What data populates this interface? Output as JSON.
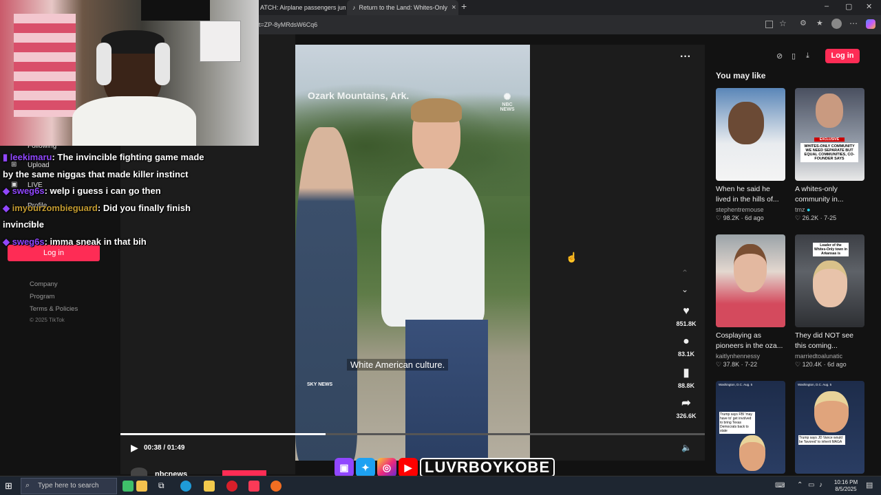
{
  "browser": {
    "tabs": [
      {
        "label": "ATCH: Airplane passengers jum"
      },
      {
        "label": "Return to the Land: Whites-Only"
      }
    ],
    "new_tab": "+",
    "url": "t=ZP-8yMRdsW6Cq6",
    "window": {
      "minimize": "–",
      "maximize": "▢",
      "close": "✕"
    }
  },
  "sidebar": {
    "nav": [
      {
        "label": "Following",
        "icon": "following-icon"
      },
      {
        "label": "Upload",
        "icon": "upload-icon"
      },
      {
        "label": "LIVE",
        "icon": "live-icon"
      },
      {
        "label": "Profile",
        "icon": "profile-icon"
      },
      {
        "label": "More",
        "icon": "more-icon"
      }
    ],
    "login_label": "Log in",
    "footer": [
      "Company",
      "Program",
      "Terms & Policies"
    ],
    "copyright": "© 2025 TikTok"
  },
  "chat": [
    {
      "user": "leekimaru",
      "message": "The invincible fighting game made",
      "cont": "by the same niggas that made killer instinct"
    },
    {
      "user": "sweg6s",
      "message": "welp i guess i can go then",
      "cont": ""
    },
    {
      "user": "imyourzombieguard",
      "message": "Did you finally finish",
      "cont": "invincible"
    },
    {
      "user": "sweg6s",
      "message": "imma sneak in that bih",
      "cont": ""
    }
  ],
  "video": {
    "location": "Ozark Mountains, Ark.",
    "watermark": "NBC NEWS",
    "caption": "White American culture.",
    "source": "SKY NEWS",
    "time": "00:38 / 01:49",
    "progress": 0.35,
    "author": "nbcnews",
    "more": "···"
  },
  "actions": [
    {
      "icon": "heart-icon",
      "glyph": "♥",
      "count": "851.8K"
    },
    {
      "icon": "comment-icon",
      "glyph": "●",
      "count": "83.1K"
    },
    {
      "icon": "bookmark-icon",
      "glyph": "▮",
      "count": "88.8K"
    },
    {
      "icon": "share-icon",
      "glyph": "➦",
      "count": "326.6K"
    }
  ],
  "topright": {
    "login_label": "Log in"
  },
  "recommend": {
    "heading": "You may like",
    "items": [
      {
        "title": "When he said he lived in the hills of...",
        "author": "stephentremouse",
        "likes": "98.2K",
        "date": "6d ago",
        "verified": false
      },
      {
        "title": "A whites-only community in...",
        "author": "tmz",
        "likes": "26.2K",
        "date": "7-25",
        "verified": true,
        "overlay": "WHITES-ONLY COMMUNITY WE NEED SEPARATE BUT EQUAL COMMUNITIES, CO-FOUNDER SAYS",
        "badge": "EXCLUSIVE"
      },
      {
        "title": "Cosplaying as pioneers in the oza...",
        "author": "kaitlynhennessy",
        "likes": "37.8K",
        "date": "7-22",
        "verified": false
      },
      {
        "title": "They did NOT see this coming...",
        "author": "marriedtoalunatic",
        "likes": "120.4K",
        "date": "6d ago",
        "verified": false,
        "overlay": "Leader of the Whites-Only town in Arkansas is"
      },
      {
        "title": "",
        "author": "",
        "likes": "",
        "date": "",
        "verified": false,
        "overlay": "Trump says FBI 'may have to' get involved to bring Texas Democrats back to state",
        "place": "Washington, D.C. Aug. 5"
      },
      {
        "title": "",
        "author": "",
        "likes": "",
        "date": "",
        "verified": false,
        "overlay": "Trump says JD Vance would be 'favored' to inherit MAGA",
        "place": "Washington, D.C. Aug. 5"
      }
    ]
  },
  "social": {
    "handle": "LUVRBOYKOBE"
  },
  "taskbar": {
    "search_placeholder": "Type here to search",
    "time": "10:16 PM",
    "date": "8/5/2025"
  },
  "colors": {
    "tiktok_red": "#fe2c55",
    "twitch": "#9147ff",
    "taskbar": "#1e2631"
  }
}
